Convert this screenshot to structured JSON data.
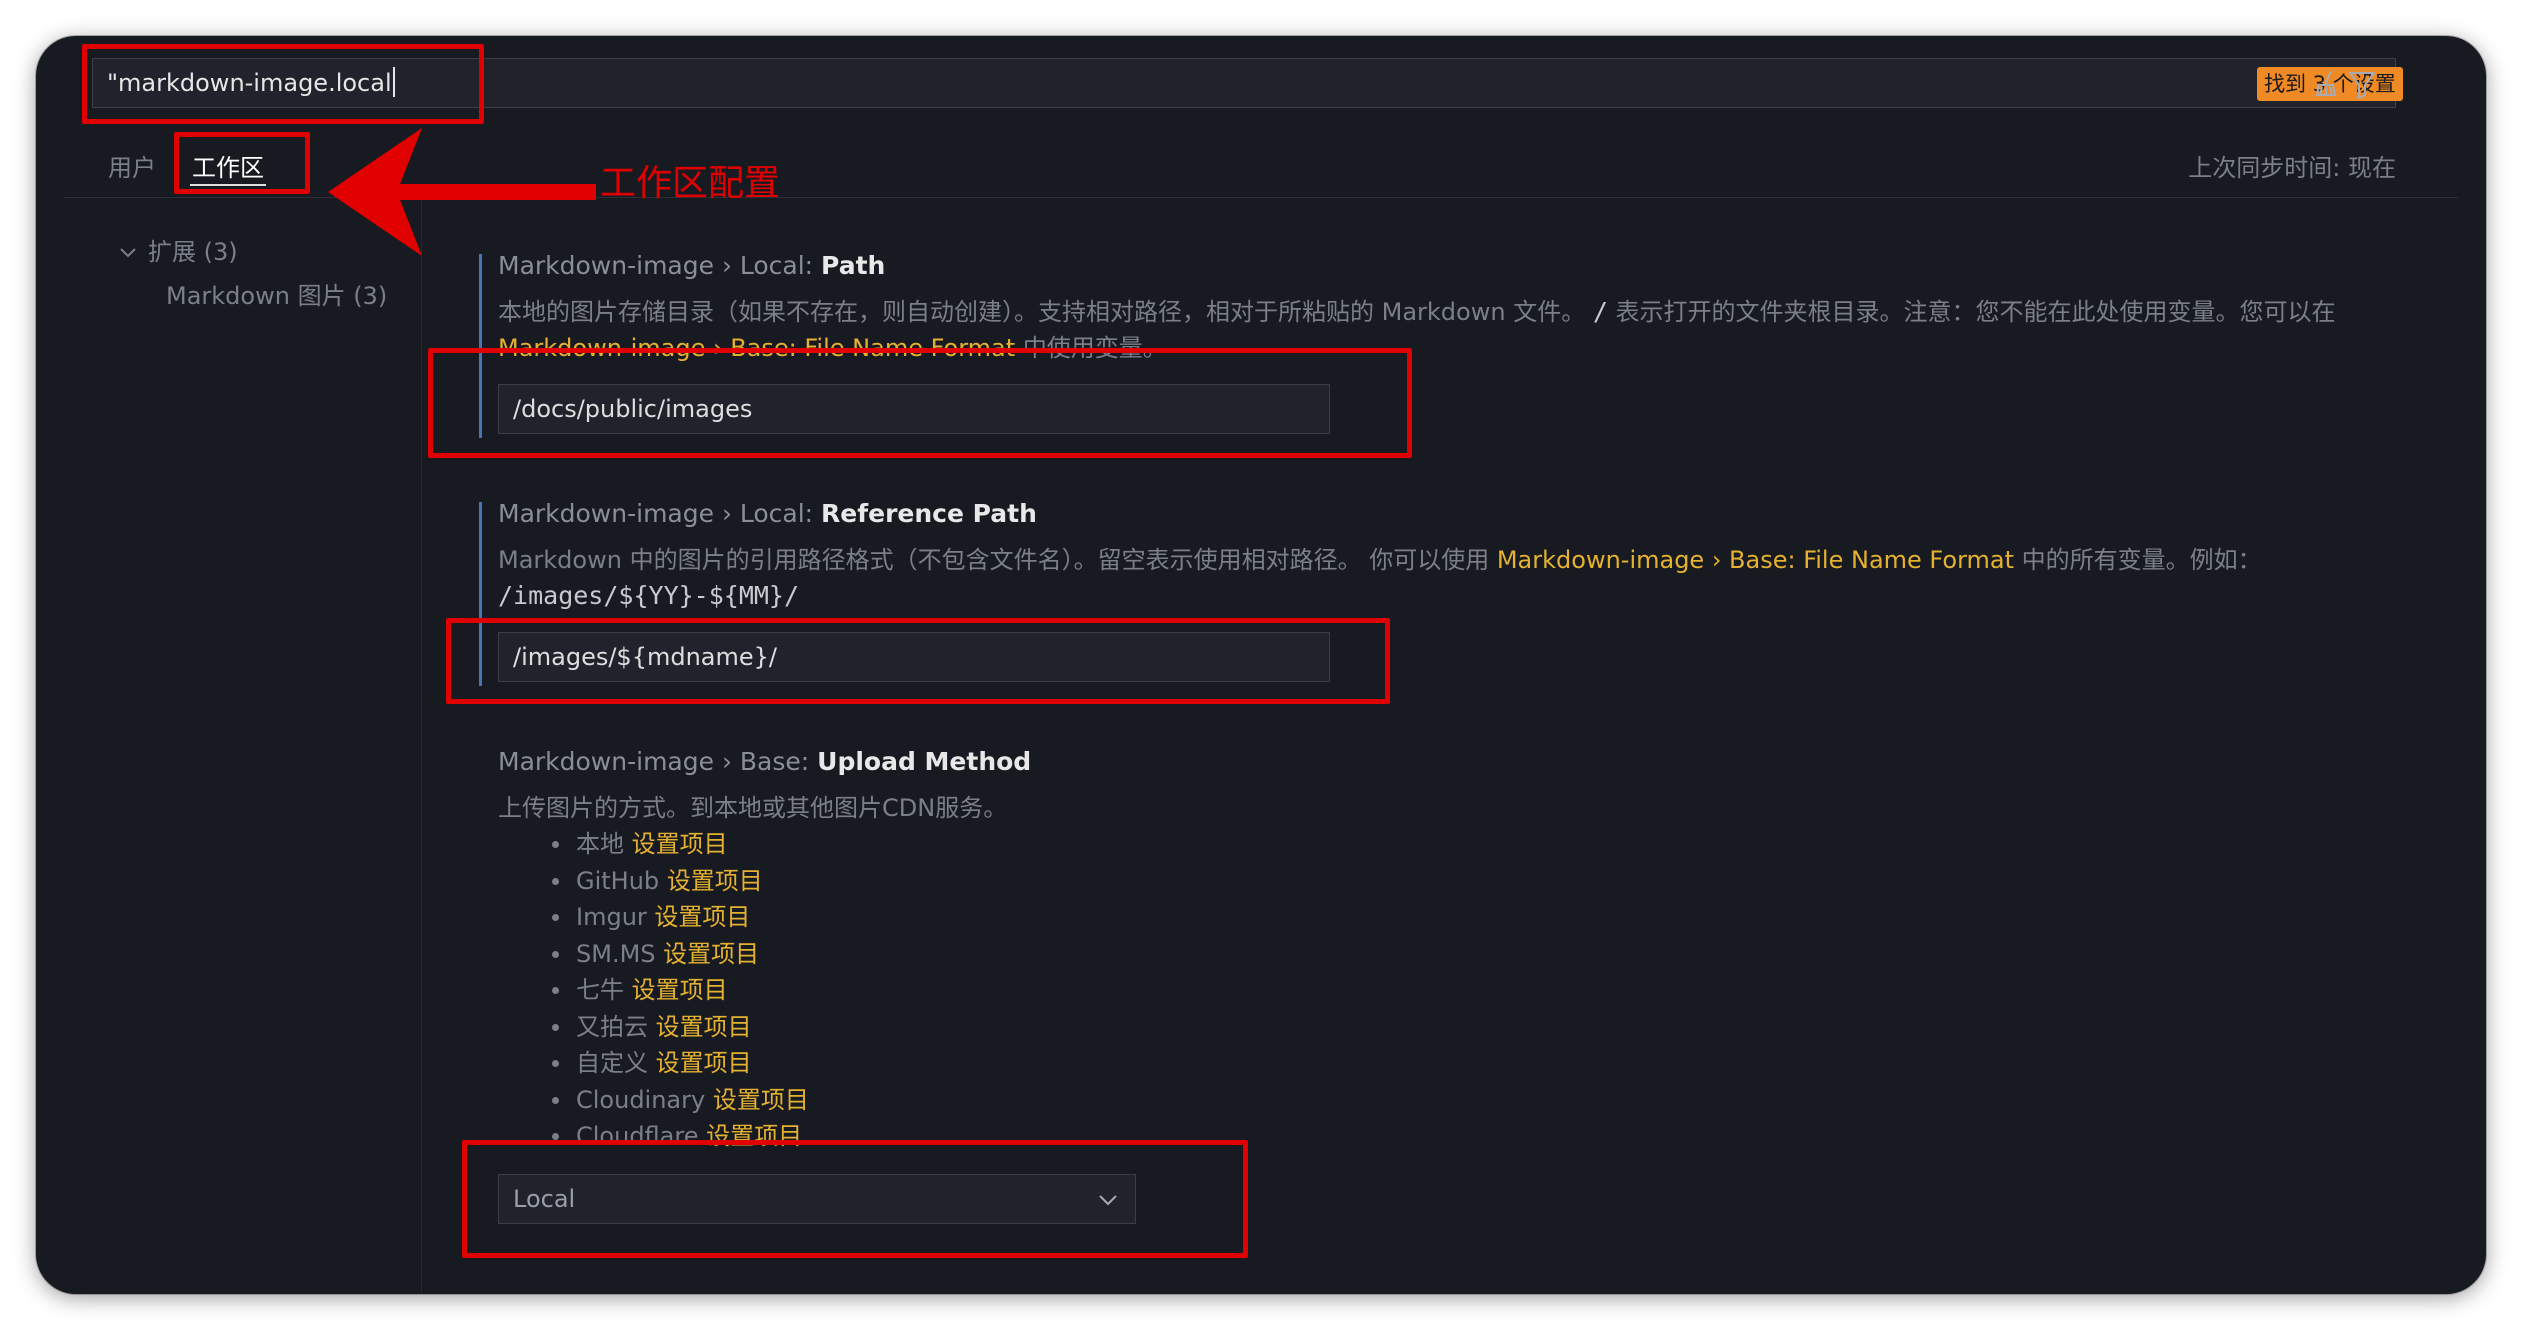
{
  "search": {
    "value": "\"markdown-image.local",
    "found_badge": "找到 3 个设置"
  },
  "tabs": [
    {
      "label": "用户"
    },
    {
      "label": "工作区"
    }
  ],
  "sync_status": "上次同步时间: 现在",
  "tree": {
    "extensions": "扩展 (3)",
    "markdown_image": "Markdown 图片 (3)"
  },
  "annotation": "工作区配置",
  "settings": {
    "local_path": {
      "prefix": "Markdown-image › Local: ",
      "name": "Path",
      "desc_1": "本地的图片存储目录（如果不存在，则自动创建）。支持相对路径，相对于所粘贴的 Markdown 文件。",
      "desc_code": "/",
      "desc_2": "表示打开的文件夹根目录。注意：您不能在此处使用变量。您可以在",
      "desc_link": "Markdown-image › Base: File Name Format",
      "desc_3": "中使用变量。",
      "value": "/docs/public/images"
    },
    "reference_path": {
      "prefix": "Markdown-image › Local: ",
      "name": "Reference Path",
      "desc_1": "Markdown 中的图片的引用路径格式（不包含文件名）。留空表示使用相对路径。 你可以使用",
      "desc_link": "Markdown-image › Base: File Name Format",
      "desc_2": "中的所有变量。例如：",
      "desc_code": "/images/${YY}-${MM}/",
      "value": "/images/${mdname}/"
    },
    "upload_method": {
      "prefix": "Markdown-image › Base: ",
      "name": "Upload Method",
      "desc": "上传图片的方式。到本地或其他图片CDN服务。",
      "link_label": "设置项目",
      "options": [
        {
          "label": "本地"
        },
        {
          "label": "GitHub"
        },
        {
          "label": "Imgur"
        },
        {
          "label": "SM.MS"
        },
        {
          "label": "七牛"
        },
        {
          "label": "又拍云"
        },
        {
          "label": "自定义"
        },
        {
          "label": "Cloudinary"
        },
        {
          "label": "Cloudflare"
        }
      ],
      "selected": "Local"
    }
  },
  "colors": {
    "annotation_red": "#e00000",
    "link_yellow": "#e5b130",
    "badge_orange": "#f08a24",
    "modified_bar": "#4a72b5"
  }
}
